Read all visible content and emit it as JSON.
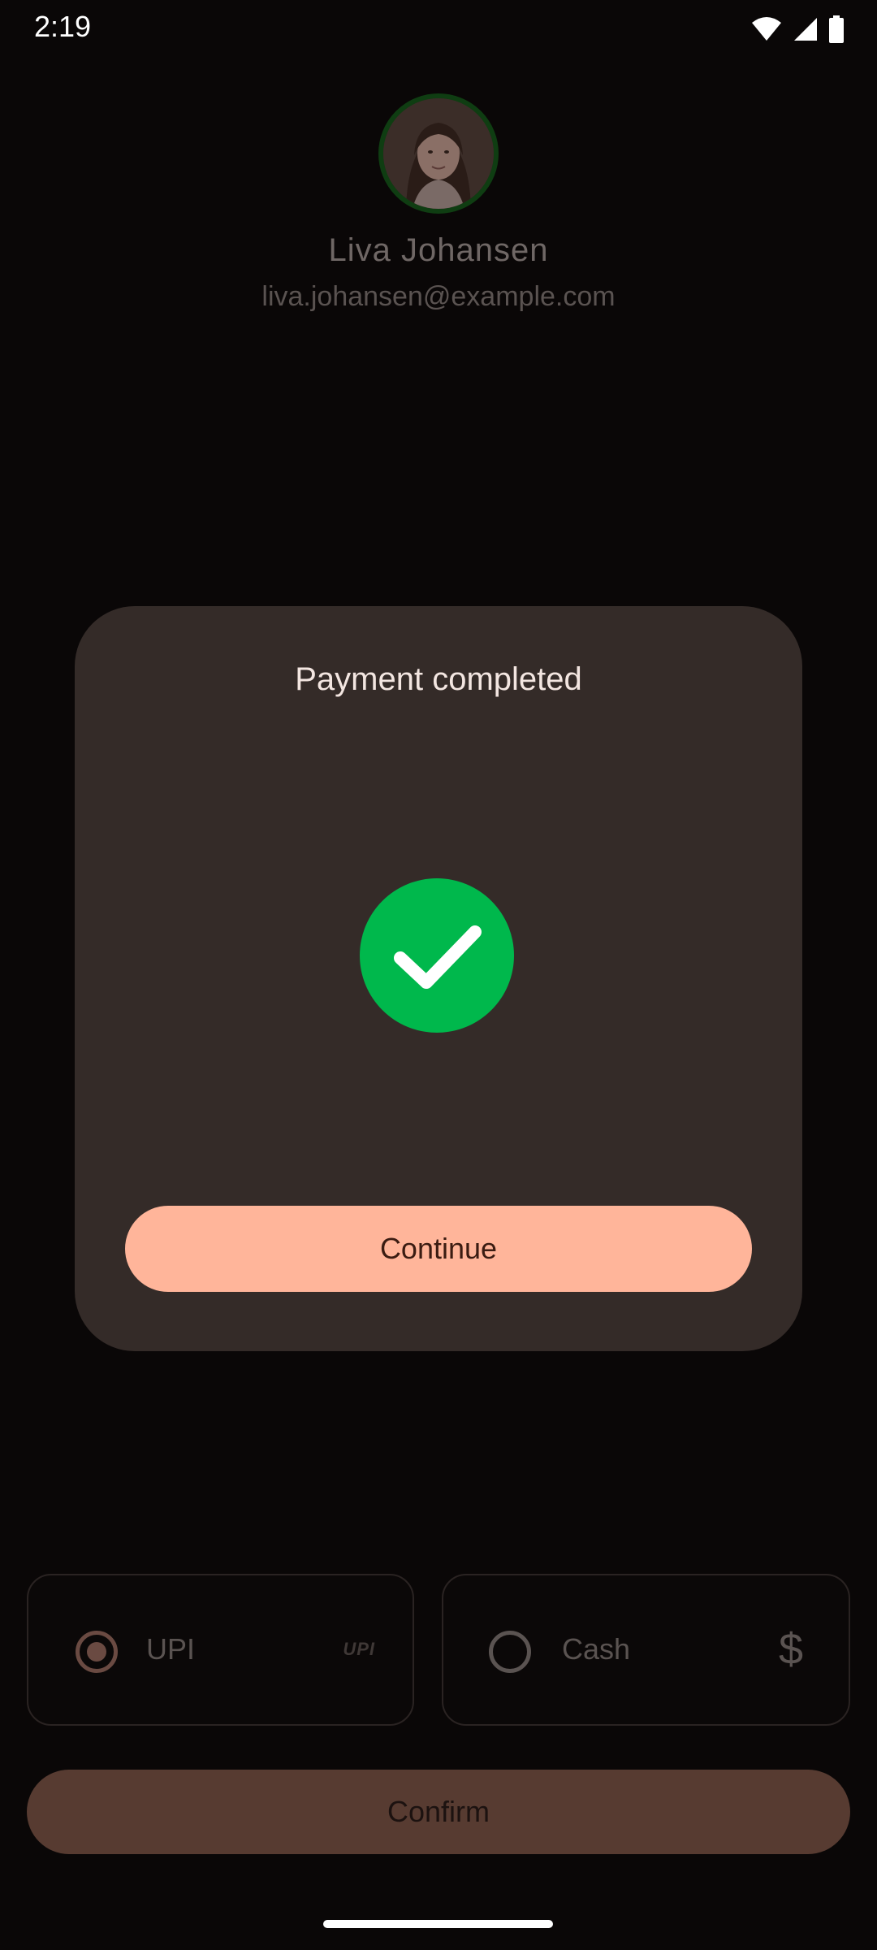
{
  "status_bar": {
    "time": "2:19",
    "icons": [
      "wifi-icon",
      "cellular-signal-icon",
      "battery-icon"
    ]
  },
  "profile": {
    "name": "Liva Johansen",
    "email": "liva.johansen@example.com",
    "avatar": "avatar"
  },
  "dialog": {
    "title": "Payment completed",
    "status_icon": "check-circle-icon",
    "continue_label": "Continue"
  },
  "payment_options": {
    "items": [
      {
        "label": "UPI",
        "selected": true,
        "logo": "UPI"
      },
      {
        "label": "Cash",
        "selected": false,
        "icon_glyph": "$"
      }
    ],
    "confirm_label": "Confirm"
  },
  "colors": {
    "success": "#00b84c",
    "accent": "#ffb59a",
    "dialog_bg": "#342b28"
  }
}
